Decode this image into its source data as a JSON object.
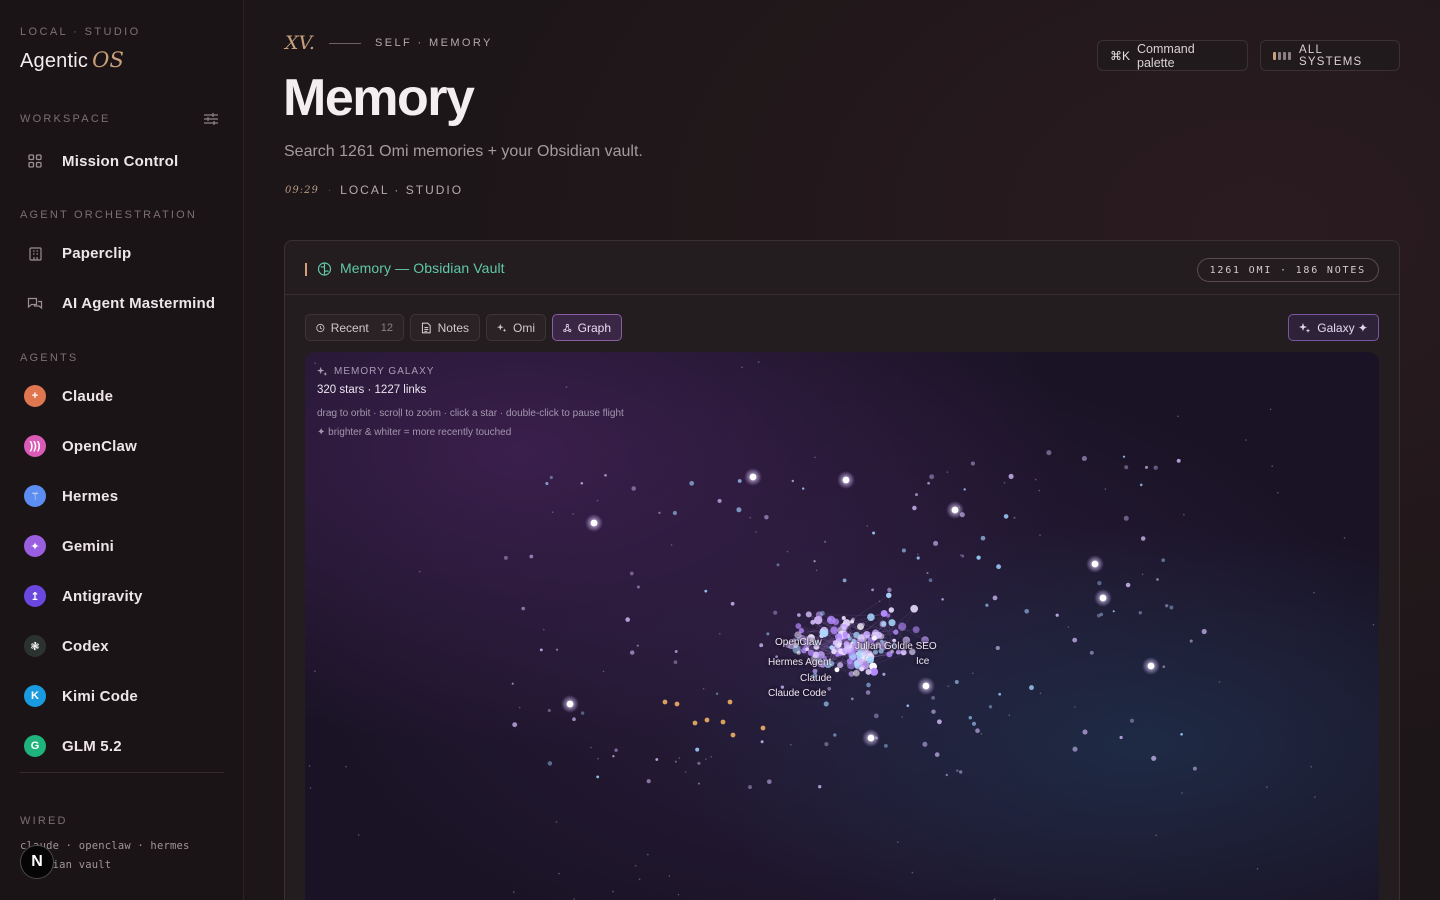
{
  "sidebar": {
    "eyebrow": "LOCAL · STUDIO",
    "brand": "Agentic",
    "brand_suffix": "OS",
    "sections": {
      "workspace": "WORKSPACE",
      "orchestration": "AGENT ORCHESTRATION",
      "agents": "AGENTS",
      "wired": "WIRED"
    },
    "workspace_items": [
      {
        "label": "Mission Control",
        "icon": "grid-icon"
      }
    ],
    "orchestration_items": [
      {
        "label": "Paperclip",
        "icon": "building-icon"
      },
      {
        "label": "AI Agent Mastermind",
        "icon": "chat-icon"
      }
    ],
    "agents": [
      {
        "label": "Claude",
        "glyph": "+",
        "color": "#e0764f"
      },
      {
        "label": "OpenClaw",
        "glyph": ")))",
        "color": "#d95bb6"
      },
      {
        "label": "Hermes",
        "glyph": "⚚",
        "color": "#5b8ef0"
      },
      {
        "label": "Gemini",
        "glyph": "✦",
        "color": "#9a5fe0"
      },
      {
        "label": "Antigravity",
        "glyph": "↥",
        "color": "#6a48e0"
      },
      {
        "label": "Codex",
        "glyph": "❃",
        "color": "#2b3330"
      },
      {
        "label": "Kimi Code",
        "glyph": "K",
        "color": "#1a9be0"
      },
      {
        "label": "GLM 5.2",
        "glyph": "G",
        "color": "#1fb47e"
      }
    ],
    "wired_line1": "claude · openclaw · hermes",
    "wired_line2": "obsidian vault",
    "badge": "N"
  },
  "header": {
    "roman": "XV.",
    "eyebrow": "SELF · MEMORY",
    "title": "Memory",
    "subtitle": "Search 1261 Omi memories + your Obsidian vault.",
    "time": "09:29",
    "location": "LOCAL · STUDIO",
    "command_key": "⌘K",
    "command_label": "Command palette",
    "systems_label": "ALL SYSTEMS"
  },
  "panel": {
    "title": "Memory — Obsidian Vault",
    "pill": "1261 OMI · 186 NOTES",
    "tabs": [
      {
        "label": "Recent",
        "count": "12"
      },
      {
        "label": "Notes"
      },
      {
        "label": "Omi"
      },
      {
        "label": "Graph"
      }
    ],
    "galaxy_button": "Galaxy ✦",
    "galaxy": {
      "eyebrow": "MEMORY GALAXY",
      "stats": "320 stars · 1227 links",
      "hint": "drag to orbit · scroll to zoom · click a star · double-click to pause flight",
      "hint2": "✦ brighter & whiter = more recently touched",
      "labels": [
        "OpenClaw",
        "Hermes Agent",
        "Claude",
        "Claude Code",
        "Julian Goldie SEO",
        "Ice"
      ]
    }
  },
  "colors": {
    "accent_gold": "#c9a07c",
    "accent_teal": "#5fc9a7",
    "accent_violet": "#8a5ea2"
  }
}
